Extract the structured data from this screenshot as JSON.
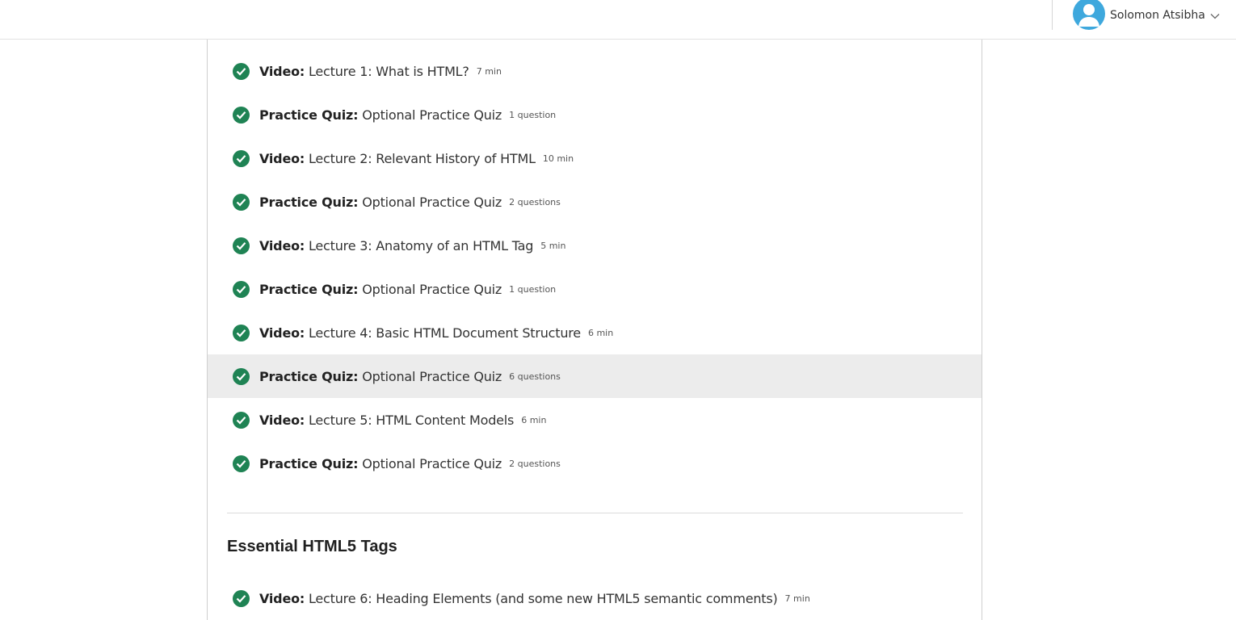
{
  "user": {
    "name": "Solomon Atsibha",
    "avatar_icon": "user-avatar-icon",
    "menu_icon": "chevron-down-icon"
  },
  "colors": {
    "check": "#1f8354",
    "avatar": "#3ea8dd",
    "active_row": "#ececec"
  },
  "lessons": [
    {
      "type": "Video:",
      "title": "Lecture 1: What is HTML?",
      "meta": "7 min",
      "completed": true
    },
    {
      "type": "Practice Quiz:",
      "title": "Optional Practice Quiz",
      "meta": "1 question",
      "completed": true
    },
    {
      "type": "Video:",
      "title": "Lecture 2: Relevant History of HTML",
      "meta": "10 min",
      "completed": true
    },
    {
      "type": "Practice Quiz:",
      "title": "Optional Practice Quiz",
      "meta": "2 questions",
      "completed": true
    },
    {
      "type": "Video:",
      "title": "Lecture 3: Anatomy of an HTML Tag",
      "meta": "5 min",
      "completed": true
    },
    {
      "type": "Practice Quiz:",
      "title": "Optional Practice Quiz",
      "meta": "1 question",
      "completed": true
    },
    {
      "type": "Video:",
      "title": "Lecture 4: Basic HTML Document Structure",
      "meta": "6 min",
      "completed": true
    },
    {
      "type": "Practice Quiz:",
      "title": "Optional Practice Quiz",
      "meta": "6 questions",
      "completed": true
    },
    {
      "type": "Video:",
      "title": "Lecture 5: HTML Content Models",
      "meta": "6 min",
      "completed": true
    },
    {
      "type": "Practice Quiz:",
      "title": "Optional Practice Quiz",
      "meta": "2 questions",
      "completed": true
    }
  ],
  "section": {
    "title": "Essential HTML5 Tags",
    "lessons": [
      {
        "type": "Video:",
        "title": "Lecture 6: Heading Elements (and some new HTML5 semantic comments)",
        "meta": "7 min",
        "completed": true
      }
    ]
  }
}
